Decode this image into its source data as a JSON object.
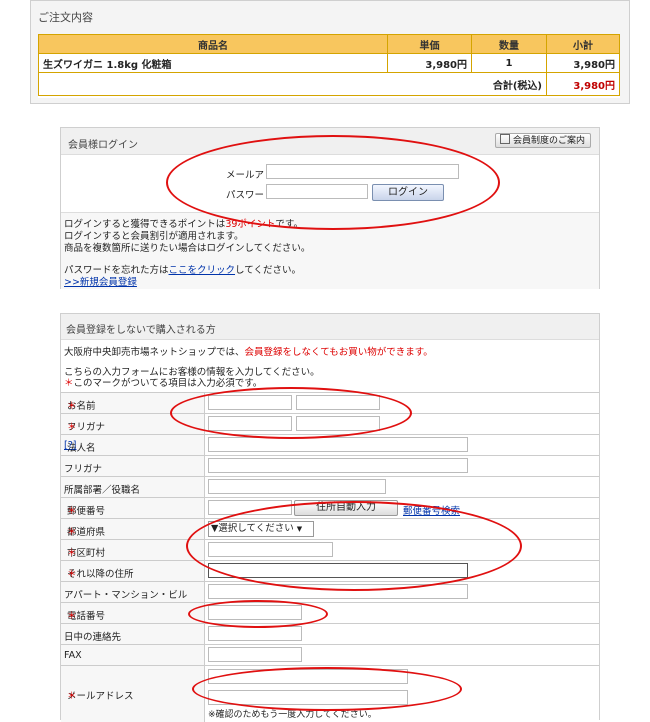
{
  "order": {
    "title": "ご注文内容",
    "headers": [
      "商品名",
      "単価",
      "数量",
      "小計"
    ],
    "item": {
      "name": "生ズワイガニ 1.8kg 化粧箱",
      "price": "3,980円",
      "qty": "1",
      "subtotal": "3,980円"
    },
    "total_label": "合計(税込)",
    "total_value": "3,980円"
  },
  "login": {
    "title": "会員様ログイン",
    "guide_button": "会員制度のご案内",
    "email_label": "メールアドレス",
    "password_label": "パスワード",
    "login_button": "ログイン",
    "info": [
      {
        "pre": "ログインすると獲得できるポイントは",
        "em": "39ポイント",
        "post": "です。"
      },
      {
        "pre": "ログインすると会員割引が適用されます。"
      },
      {
        "pre": "商品を複数箇所に送りたい場合はログインしてください。"
      }
    ],
    "forgot_pre": "パスワードを忘れた方は",
    "forgot_link": "ここをクリック",
    "forgot_post": "してください。",
    "register_link": ">>新規会員登録"
  },
  "guest": {
    "title": "会員登録をしないで購入される方",
    "intro_pre": "大阪府中央卸売市場ネットショップでは、",
    "intro_red": "会員登録をしなくてもお買い物ができます。",
    "line1": "こちらの入力フォームにお客様の情報を入力してください。",
    "line2_star": "＊",
    "line2": "このマークがついてる項目は入力必須です。",
    "fields": {
      "name": "お名前",
      "furigana": "フリガナ",
      "company": "法人名",
      "company_help": "[?]",
      "company_kana": "フリガナ",
      "dept": "所属部署／役職名",
      "zip": "郵便番号",
      "prefecture": "都道府県",
      "city": "市区町村",
      "address": "それ以降の住所",
      "building": "アパート・マンション・ビル",
      "phone": "電話番号",
      "daytime": "日中の連絡先",
      "fax": "FAX",
      "email": "メールアドレス"
    },
    "required_mark": "＊",
    "zip_button": "住所自動入力",
    "zip_search_link": "郵便番号検索",
    "prefecture_selected": "▼選択してください",
    "email_confirm_note": "※確認のためもう一度入力してください。"
  },
  "colors": {
    "header_bg": "#f8c65e",
    "required": "#dd0000",
    "annotation": "#e01010",
    "link": "#0033aa"
  }
}
